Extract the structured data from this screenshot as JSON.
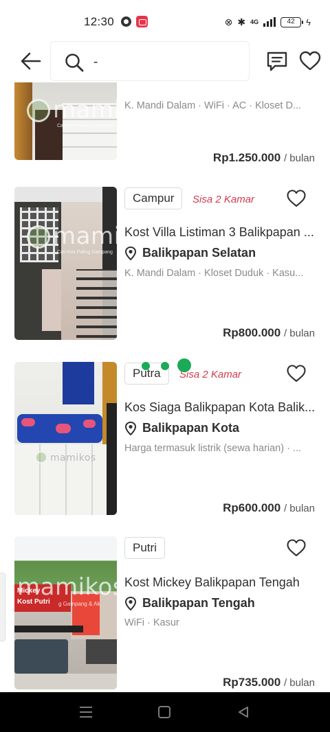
{
  "status_bar": {
    "time": "12:30",
    "battery": "42",
    "network": "4G"
  },
  "search": {
    "query": "-"
  },
  "listings": [
    {
      "facilities": "K. Mandi Dalam · WiFi · AC · Kloset D...",
      "price": "Rp1.250.000",
      "period": "/ bulan",
      "watermark": "mamik",
      "watermark_sub": "Cari Kos Paling Gampang"
    },
    {
      "type": "Campur",
      "remaining": "Sisa 2 Kamar",
      "title": "Kost Villa Listiman 3 Balikpapan ...",
      "location": "Balikpapan Selatan",
      "facilities": "K. Mandi Dalam · Kloset Duduk · Kasu...",
      "price": "Rp800.000",
      "period": "/ bulan",
      "watermark": "mamik",
      "watermark_sub": "Cari Kos Paling Gampang"
    },
    {
      "type": "Putra",
      "remaining": "Sisa 2 Kamar",
      "title": "Kos Siaga  Balikpapan Kota Balik...",
      "location": "Balikpapan Kota",
      "facilities": "Harga termasuk listrik (sewa harian) · ...",
      "price": "Rp600.000",
      "period": "/ bulan",
      "watermark": "mamikos"
    },
    {
      "type": "Putri",
      "title": "Kost Mickey Balikpapan Tengah",
      "location": "Balikpapan Tengah",
      "facilities": "WiFi · Kasur",
      "price": "Rp735.000",
      "period": "/ bulan",
      "watermark": "mamikos",
      "sign_line1": "Mickey",
      "sign_line2": "Kost Putri",
      "watermark_sub": "g Gampang & Ak"
    }
  ],
  "colors": {
    "accent_red": "#d43b4e",
    "green_dot": "#1baa56"
  },
  "icons": {
    "back": "arrow-left-icon",
    "search": "search-icon",
    "chat": "chat-icon",
    "favorite": "heart-icon",
    "location": "location-pin-icon"
  }
}
